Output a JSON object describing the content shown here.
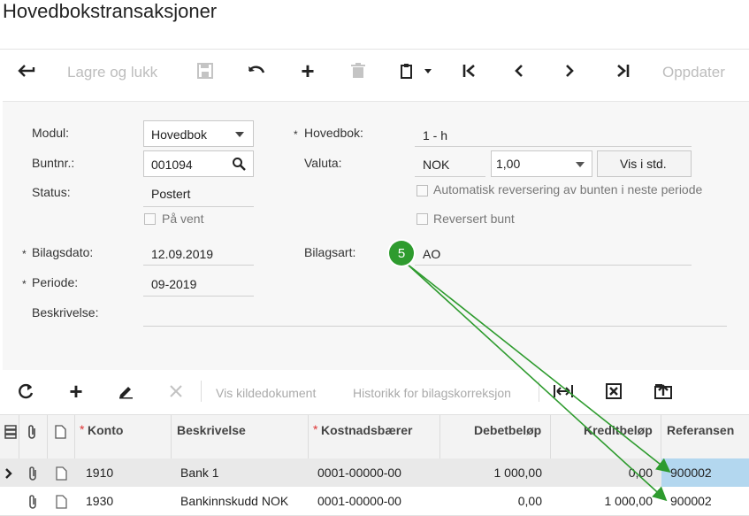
{
  "page": {
    "title": "Hovedbokstransaksjoner"
  },
  "toolbar": {
    "back_icon": "back-arrow-icon",
    "save_close_label": "Lagre og lukk",
    "refresh_label": "Oppdater"
  },
  "form": {
    "modul_label": "Modul:",
    "modul_value": "Hovedbok",
    "buntnr_label": "Buntnr.:",
    "buntnr_value": "001094",
    "status_label": "Status:",
    "status_value": "Postert",
    "paa_vent_label": "På vent",
    "hovedbok_label": "Hovedbok:",
    "hovedbok_value": "1 - h",
    "valuta_label": "Valuta:",
    "valuta_value": "NOK",
    "rate_value": "1,00",
    "vis_i_std_label": "Vis i std.",
    "auto_reversering_label": "Automatisk reversering av bunten i neste periode",
    "reversert_bunt_label": "Reversert bunt",
    "bilagsdato_label": "Bilagsdato:",
    "bilagsdato_value": "12.09.2019",
    "periode_label": "Periode:",
    "periode_value": "09-2019",
    "beskrivelse_label": "Beskrivelse:",
    "bilagsart_label": "Bilagsart:",
    "bilagsart_value": "AO",
    "required_mark": "*"
  },
  "grid_toolbar": {
    "vis_kildedokument": "Vis kildedokument",
    "historikk": "Historikk for bilagskorreksjon"
  },
  "table": {
    "headers": {
      "konto": "Konto",
      "beskrivelse": "Beskrivelse",
      "kostnadsbaerer": "Kostnadsbærer",
      "debet": "Debetbeløp",
      "kredit": "Kreditbeløp",
      "referansen": "Referansen"
    },
    "rows": [
      {
        "konto": "1910",
        "beskrivelse": "Bank 1",
        "kostnadsbaerer": "0001-00000-00",
        "debet": "1 000,00",
        "kredit": "0,00",
        "referansen": "900002"
      },
      {
        "konto": "1930",
        "beskrivelse": "Bankinnskudd NOK",
        "kostnadsbaerer": "0001-00000-00",
        "debet": "0,00",
        "kredit": "1 000,00",
        "referansen": "900002"
      }
    ]
  },
  "annotation": {
    "badge_number": "5",
    "color": "#2e9b2e"
  }
}
